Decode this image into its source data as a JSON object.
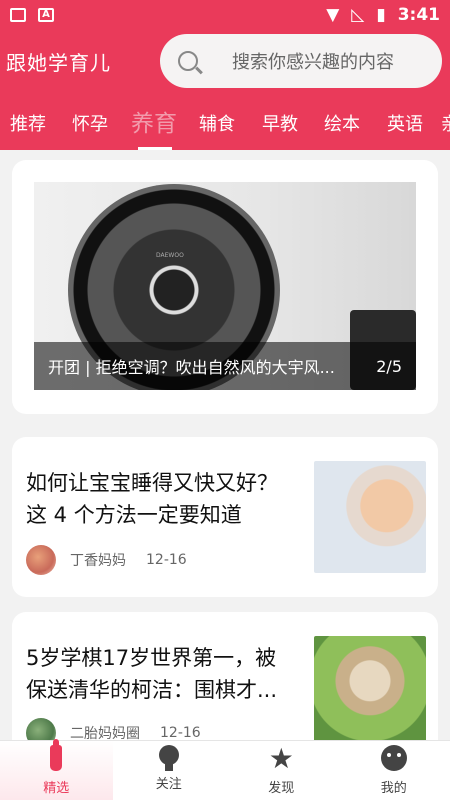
{
  "status_bar": {
    "time": "3:41"
  },
  "header": {
    "app_title": "跟她学育儿",
    "search_placeholder": "搜索你感兴趣的内容"
  },
  "tabs": [
    "推荐",
    "怀孕",
    "养育",
    "辅食",
    "早教",
    "绘本",
    "英语",
    "亲"
  ],
  "active_tab": "养育",
  "banner": {
    "caption": "开团 | 拒绝空调？吹出自然风的大宇风...",
    "counter": "2/5",
    "fan_brand": "DAEWOO"
  },
  "articles": [
    {
      "title": "如何让宝宝睡得又快又好？这 4 个方法一定要知道",
      "author": "丁香妈妈",
      "date": "12-16"
    },
    {
      "title": "5岁学棋17岁世界第一，被保送清华的柯洁：围棋才...",
      "author": "二胎妈妈圈",
      "date": "12-16"
    }
  ],
  "bottom_nav": [
    {
      "label": "精选",
      "icon": "bottle-icon"
    },
    {
      "label": "关注",
      "icon": "bulb-icon"
    },
    {
      "label": "发现",
      "icon": "star-icon"
    },
    {
      "label": "我的",
      "icon": "face-icon"
    }
  ],
  "colors": {
    "brand": "#ea3a5a",
    "active_tab": "#f29aab"
  }
}
